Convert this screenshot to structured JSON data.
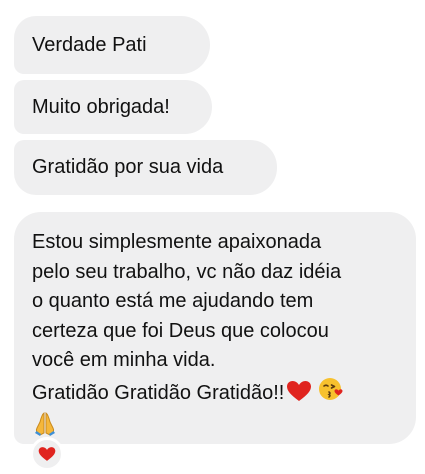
{
  "messages": [
    {
      "text": "Verdade Pati"
    },
    {
      "text": "Muito obrigada!"
    },
    {
      "text": "Gratidão por sua vida"
    },
    {
      "text": "Estou simplesmente apaixonada\npelo seu trabalho, vc não daz idéia\no quanto está me ajudando tem\ncerteza que foi Deus que colocou\nvocê em minha vida.\nGratidão Gratidão Gratidão!!",
      "emojis": [
        "red-heart",
        "face-blowing-kiss",
        "folded-hands"
      ]
    }
  ],
  "reaction": {
    "emoji": "red-heart"
  },
  "colors": {
    "bubble": "#efeff0",
    "text": "#111111",
    "heart": "#e0241f"
  }
}
